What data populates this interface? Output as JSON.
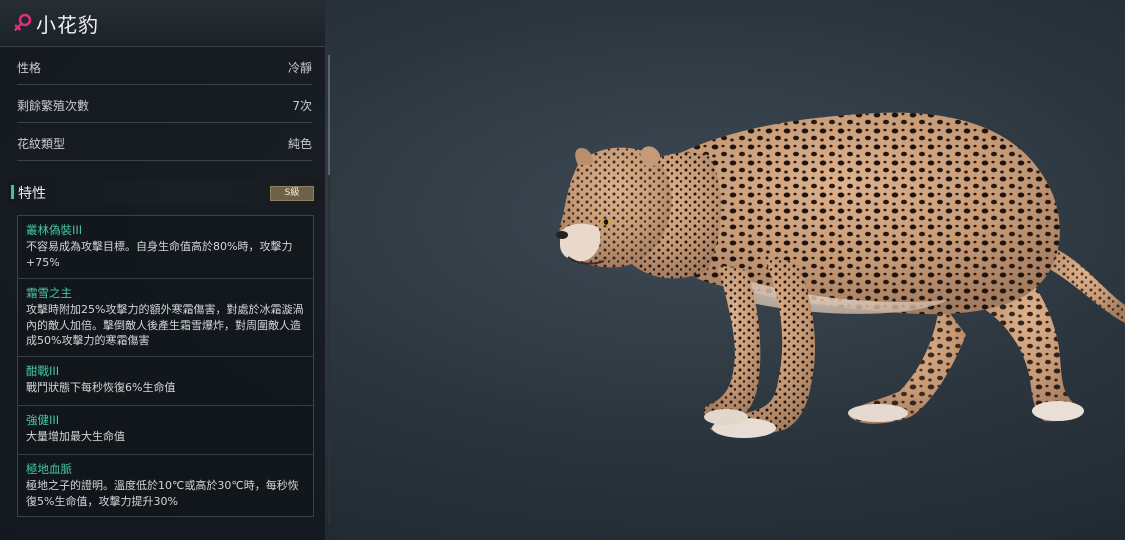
{
  "creature": {
    "name": "小花豹",
    "gender_icon": "female-icon",
    "gender_color": "#e0307a"
  },
  "attributes": [
    {
      "label": "性格",
      "value": "冷靜"
    },
    {
      "label": "剩餘繁殖次數",
      "value": "7次"
    },
    {
      "label": "花紋類型",
      "value": "純色"
    }
  ],
  "traits_section": {
    "title": "特性",
    "grade": "S級"
  },
  "traits": [
    {
      "name": "叢林偽裝III",
      "desc": "不容易成為攻擊目標。自身生命值高於80%時，攻擊力+75%"
    },
    {
      "name": "霜雪之主",
      "desc": "攻擊時附加25%攻擊力的額外寒霜傷害，對處於冰霜漩渦內的敵人加倍。擊倒敵人後產生霜雪爆炸，對周圍敵人造成50%攻擊力的寒霜傷害"
    },
    {
      "name": "酣戰III",
      "desc": "戰鬥狀態下每秒恢復6%生命值"
    },
    {
      "name": "強健III",
      "desc": "大量增加最大生命值"
    },
    {
      "name": "極地血脈",
      "desc": "極地之子的證明。溫度低於10℃或高於30℃時，每秒恢復5%生命值，攻擊力提升30%"
    }
  ],
  "colors": {
    "trait_name": "#43c7a0",
    "accent_bar": "#3ec49a",
    "grade_badge": "#6d6247"
  }
}
